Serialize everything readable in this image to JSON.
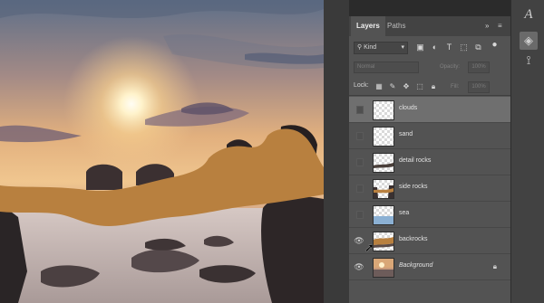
{
  "colors": {
    "accent": "#b57a3c",
    "panel": "#535353",
    "selected": "#6f6f6f"
  },
  "tabs": [
    {
      "label": "Layers",
      "active": true
    },
    {
      "label": "Paths",
      "active": false
    }
  ],
  "tab_controls": {
    "collapse": "»",
    "menu": "≡"
  },
  "filter": {
    "kind_label": "Kind",
    "search_icon": "search-icon"
  },
  "blend": {
    "mode": "Normal",
    "opacity_label": "Opacity:",
    "opacity_value": "100%"
  },
  "lock": {
    "label": "Lock:",
    "fill_label": "Fill:",
    "fill_value": "100%"
  },
  "layers": [
    {
      "name": "clouds",
      "visible": false,
      "selected": true
    },
    {
      "name": "sand",
      "visible": false
    },
    {
      "name": "detail rocks",
      "visible": false
    },
    {
      "name": "side rocks",
      "visible": false
    },
    {
      "name": "sea",
      "visible": false
    },
    {
      "name": "backrocks",
      "visible": true
    },
    {
      "name": "Background",
      "visible": true,
      "locked": true
    }
  ],
  "dock": [
    "character-icon",
    "layers-icon",
    "paths-icon"
  ]
}
